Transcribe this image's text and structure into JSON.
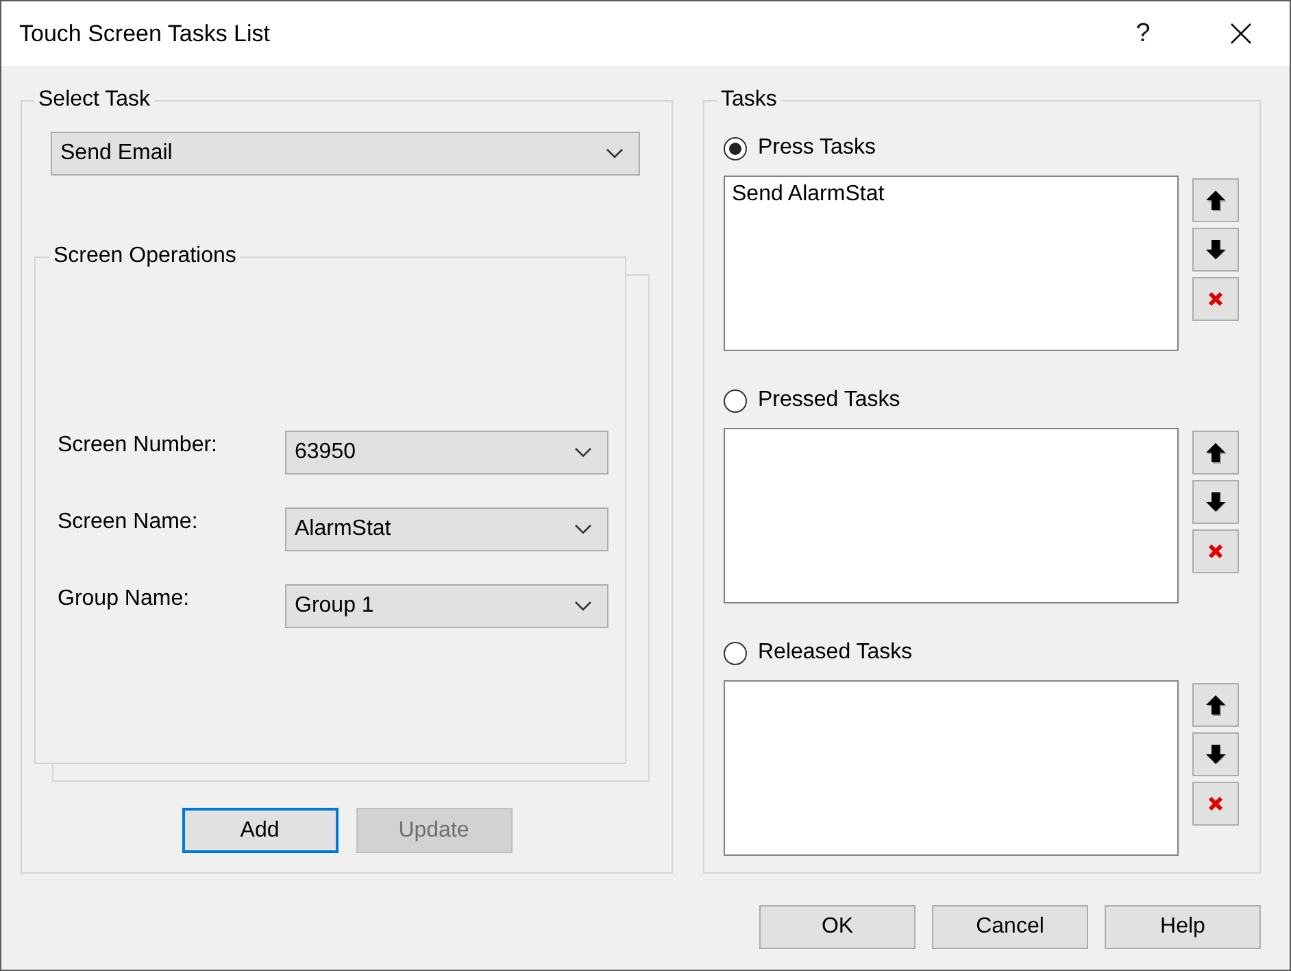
{
  "window": {
    "title": "Touch Screen Tasks List",
    "help_glyph": "?"
  },
  "select_task": {
    "title": "Select Task",
    "task_dropdown": {
      "value": "Send Email"
    },
    "screen_operations": {
      "title": "Screen Operations",
      "fields": [
        {
          "label": "Screen Number:",
          "value": "63950"
        },
        {
          "label": "Screen Name:",
          "value": "AlarmStat"
        },
        {
          "label": "Group Name:",
          "value": "Group 1"
        }
      ]
    },
    "buttons": [
      {
        "label": "Add",
        "focused": true,
        "disabled": false
      },
      {
        "label": "Update",
        "focused": false,
        "disabled": true
      }
    ]
  },
  "tasks": {
    "title": "Tasks",
    "groups": [
      {
        "label": "Press Tasks",
        "selected": true,
        "items": [
          "Send AlarmStat"
        ]
      },
      {
        "label": "Pressed Tasks",
        "selected": false
      },
      {
        "label": "Released Tasks",
        "selected": false
      }
    ]
  },
  "footer_buttons": [
    "OK",
    "Cancel",
    "Help"
  ]
}
